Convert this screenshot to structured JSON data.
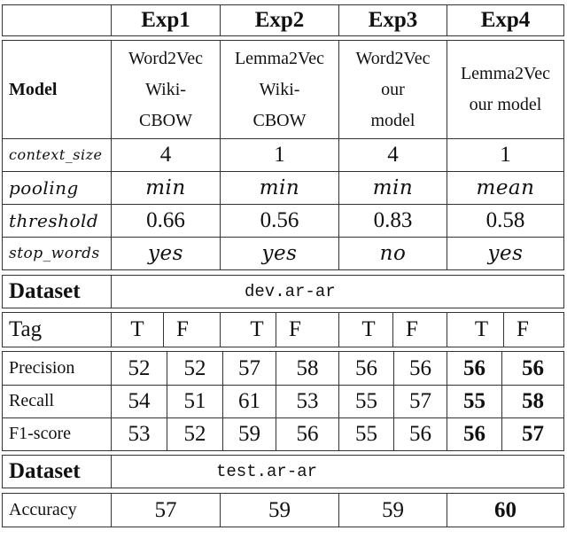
{
  "header": {
    "corner": "",
    "experiments": [
      "Exp1",
      "Exp2",
      "Exp3",
      "Exp4"
    ]
  },
  "config": {
    "model_label": "Model",
    "models": [
      [
        "Word2Vec",
        "Wiki-",
        "CBOW"
      ],
      [
        "Lemma2Vec",
        "Wiki-",
        "CBOW"
      ],
      [
        "Word2Vec",
        "our",
        "model"
      ],
      [
        "Lemma2Vec",
        "our model"
      ]
    ],
    "params": [
      {
        "label": "context_size",
        "values": [
          "4",
          "1",
          "4",
          "1"
        ]
      },
      {
        "label": "pooling",
        "values": [
          "min",
          "min",
          "min",
          "mean"
        ]
      },
      {
        "label": "threshold",
        "values": [
          "0.66",
          "0.56",
          "0.83",
          "0.58"
        ]
      },
      {
        "label": "stop_words",
        "values": [
          "yes",
          "yes",
          "no",
          "yes"
        ]
      }
    ]
  },
  "dev": {
    "dataset_label": "Dataset",
    "dataset_name": "dev.ar-ar",
    "tag_label": "Tag",
    "tags": [
      "T",
      "F",
      "T",
      "F",
      "T",
      "F",
      "T",
      "F"
    ],
    "metrics": [
      {
        "label": "Precision",
        "values": [
          "52",
          "52",
          "57",
          "58",
          "56",
          "56",
          "56",
          "56"
        ]
      },
      {
        "label": "Recall",
        "values": [
          "54",
          "51",
          "61",
          "53",
          "55",
          "57",
          "55",
          "58"
        ]
      },
      {
        "label": "F1-score",
        "values": [
          "53",
          "52",
          "59",
          "56",
          "55",
          "56",
          "56",
          "57"
        ]
      }
    ],
    "bold_experiment_index": 3
  },
  "test": {
    "dataset_label": "Dataset",
    "dataset_name": "test.ar-ar",
    "accuracy_label": "Accuracy",
    "accuracy": [
      "57",
      "59",
      "59",
      "60"
    ],
    "bold_experiment_index": 3
  }
}
